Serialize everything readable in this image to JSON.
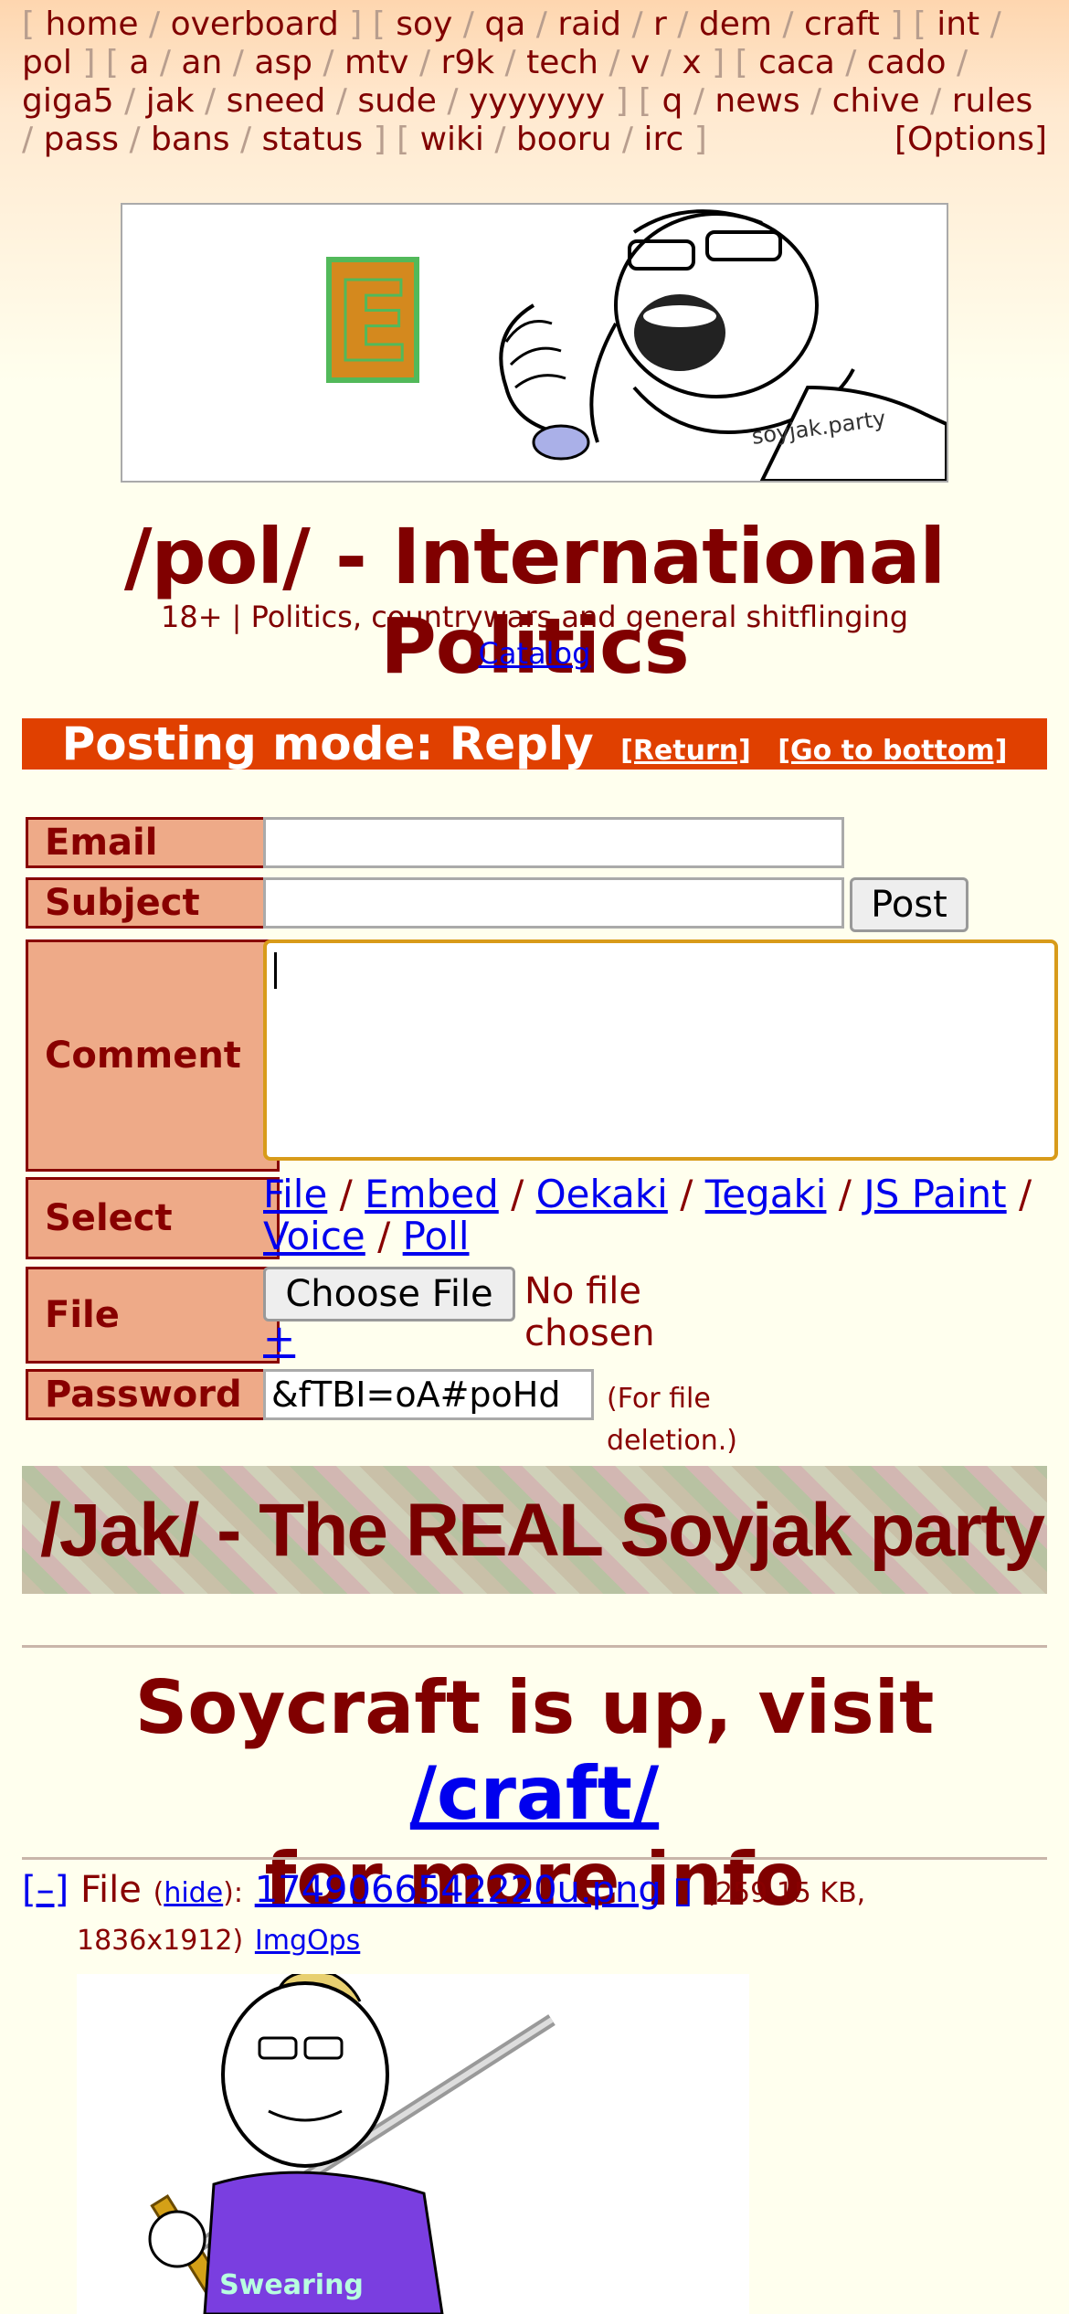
{
  "boardlist": {
    "groups": [
      [
        "home",
        "overboard"
      ],
      [
        "soy",
        "qa",
        "raid",
        "r",
        "dem",
        "craft"
      ],
      [
        "int",
        "pol"
      ],
      [
        "a",
        "an",
        "asp",
        "mtv",
        "r9k",
        "tech",
        "v",
        "x"
      ],
      [
        "caca",
        "cado",
        "giga5",
        "jak",
        "sneed",
        "sude",
        "yyyyyyy"
      ],
      [
        "q",
        "news",
        "chive",
        "rules",
        "pass",
        "bans",
        "status"
      ],
      [
        "wiki",
        "booru",
        "irc"
      ]
    ],
    "options": "[Options]"
  },
  "banner": {
    "letter": "E",
    "watermark": "soyjak.party"
  },
  "board": {
    "title": "/pol/ - International Politics",
    "subtitle": "18+ | Politics, countrywars and general shitflinging",
    "catalog": "Catalog"
  },
  "posting_mode": {
    "label": "Posting mode: Reply",
    "return_link": "[Return]",
    "bottom_link": "[Go to bottom]",
    "bg_color": "#e04000"
  },
  "form": {
    "email_label": "Email",
    "subject_label": "Subject",
    "post_button": "Post",
    "comment_label": "Comment",
    "select_label": "Select",
    "select_options": [
      "File",
      "Embed",
      "Oekaki",
      "Tegaki",
      "JS Paint",
      "Voice",
      "Poll"
    ],
    "file_label": "File",
    "choose_file": "Choose File",
    "no_file": "No file chosen",
    "add_more": "+",
    "password_label": "Password",
    "password_value": "&fTBI=oA#poHd",
    "password_note": "(For file deletion.)"
  },
  "jak_banner": "/Jak/ - The REAL Soyjak party",
  "announcement": {
    "text1": "Soycraft is up, visit ",
    "link": "/craft/",
    "text2": "for more info"
  },
  "post": {
    "toggle": "[–]",
    "file_word": "File",
    "hide": "hide",
    "filename": "1749066542220u.png",
    "icon_glyph": "▯",
    "meta1": "(259.15 KB,",
    "meta2": "1836x1912)",
    "imgops": "ImgOps",
    "shirt_text": "Swearing"
  }
}
